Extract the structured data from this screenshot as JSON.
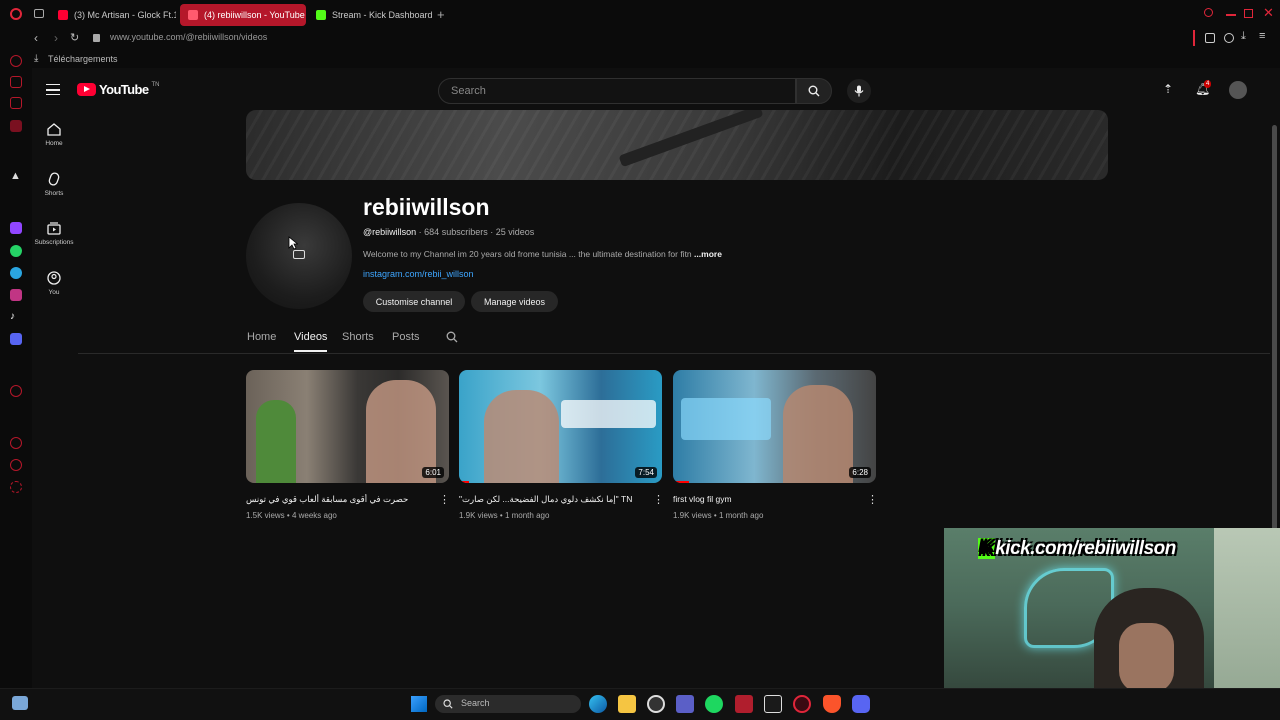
{
  "browser": {
    "tabs": [
      {
        "label": "(3) Mc Artisan - Glock Ft.1",
        "favicon_color": "#ff0033"
      },
      {
        "label": "(4) rebiiwillson - YouTube",
        "favicon_color": "#ff0033"
      },
      {
        "label": "Stream - Kick Dashboard",
        "favicon_color": "#53fc18"
      }
    ],
    "url": "www.youtube.com/@rebiiwillson/videos",
    "downloads_label": "Téléchargements",
    "accent": "#ff0033"
  },
  "youtube": {
    "logo_text": "YouTube",
    "logo_region": "TN",
    "search_placeholder": "Search",
    "notification_count": "4",
    "guide": [
      {
        "label": "Home",
        "icon": "home-icon"
      },
      {
        "label": "Shorts",
        "icon": "shorts-icon"
      },
      {
        "label": "Subscriptions",
        "icon": "subscriptions-icon"
      },
      {
        "label": "You",
        "icon": "you-icon"
      }
    ]
  },
  "channel": {
    "name": "rebiiwillson",
    "handle": "@rebiiwillson",
    "subscribers": "684 subscribers",
    "videos_count": "25 videos",
    "description": "Welcome to my Channel im 20 years old frome tunisia ...   the ultimate destination for fitn",
    "more_label": "...more",
    "link": "instagram.com/rebii_willson",
    "customise_button": "Customise channel",
    "manage_button": "Manage videos",
    "tabs": [
      "Home",
      "Videos",
      "Shorts",
      "Posts"
    ],
    "active_tab": "Videos"
  },
  "videos": [
    {
      "title": "حصرت في أقوى مسابقة ألعاب قوي في تونس",
      "views": "1.5K views",
      "age": "4 weeks ago",
      "duration": "6:01",
      "progress": 0
    },
    {
      "title": "\"إما نكشف دلوي دمال الفضيحة... لكن صارت\" TN",
      "views": "1.9K views",
      "age": "1 month ago",
      "duration": "7:54",
      "progress": 0.05
    },
    {
      "title": "first vlog fil gym",
      "views": "1.9K views",
      "age": "1 month ago",
      "duration": "6:28",
      "progress": 0.08
    }
  ],
  "webcam": {
    "label": "kick.com/rebiiwillson",
    "label_prefix": "K"
  },
  "taskbar": {
    "search_placeholder": "Search"
  }
}
